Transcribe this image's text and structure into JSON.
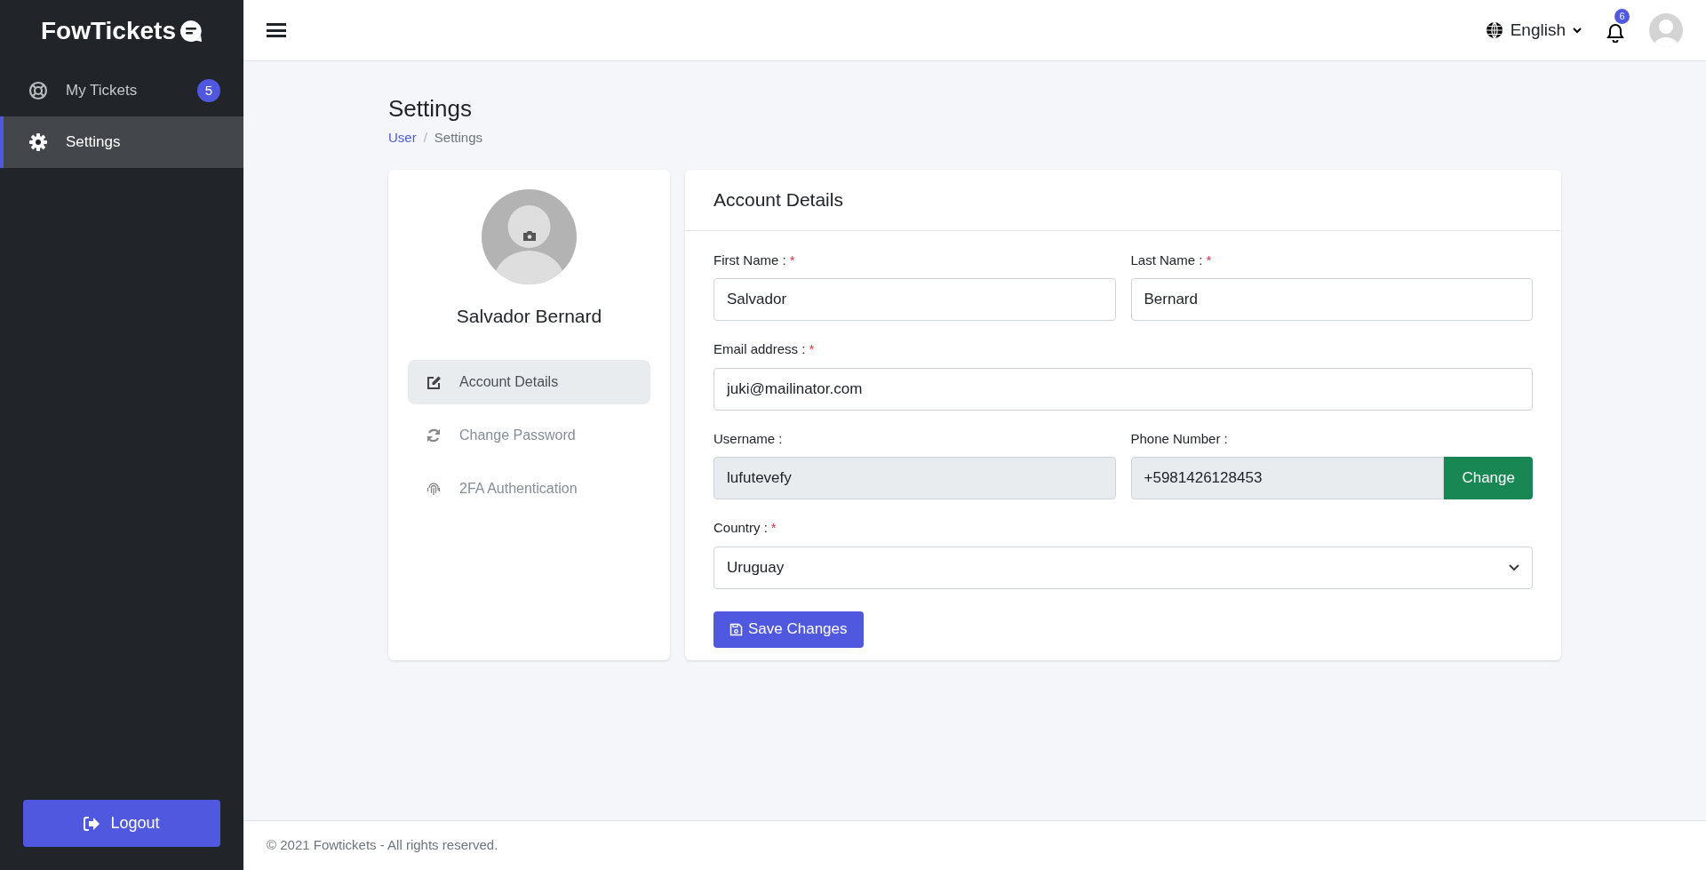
{
  "sidebar": {
    "logo": "FowTickets",
    "items": [
      {
        "label": "My Tickets",
        "badge": "5",
        "selected": false
      },
      {
        "label": "Settings",
        "selected": true
      }
    ],
    "logout": "Logout"
  },
  "header": {
    "language": "English",
    "notification_count": "6"
  },
  "page": {
    "title": "Settings",
    "breadcrumb_separator": "/",
    "breadcrumb": [
      {
        "label": "User",
        "link": true
      },
      {
        "label": "Settings",
        "link": false
      }
    ]
  },
  "profile": {
    "name": "Salvador Bernard",
    "menu": [
      {
        "label": "Account Details",
        "selected": true
      },
      {
        "label": "Change Password",
        "selected": false
      },
      {
        "label": "2FA Authentication",
        "selected": false
      }
    ]
  },
  "account": {
    "title": "Account Details",
    "required_mark": "*",
    "rows": [
      [
        {
          "label": "First Name :",
          "required": true,
          "kind": "text",
          "value": "Salvador",
          "disabled": false
        },
        {
          "label": "Last Name :",
          "required": true,
          "kind": "text",
          "value": "Bernard",
          "disabled": false
        }
      ],
      [
        {
          "label": "Email address :",
          "required": true,
          "kind": "text",
          "value": "juki@mailinator.com",
          "disabled": false
        }
      ],
      [
        {
          "label": "Username :",
          "required": false,
          "kind": "text",
          "value": "lufutevefy",
          "disabled": true
        },
        {
          "label": "Phone Number :",
          "required": false,
          "kind": "phone",
          "value": "+5981426128453",
          "disabled": true,
          "button": "Change"
        }
      ],
      [
        {
          "label": "Country :",
          "required": true,
          "kind": "select",
          "value": "Uruguay",
          "disabled": false
        }
      ]
    ],
    "save": "Save Changes"
  },
  "footer": "© 2021 Fowtickets - All rights reserved."
}
